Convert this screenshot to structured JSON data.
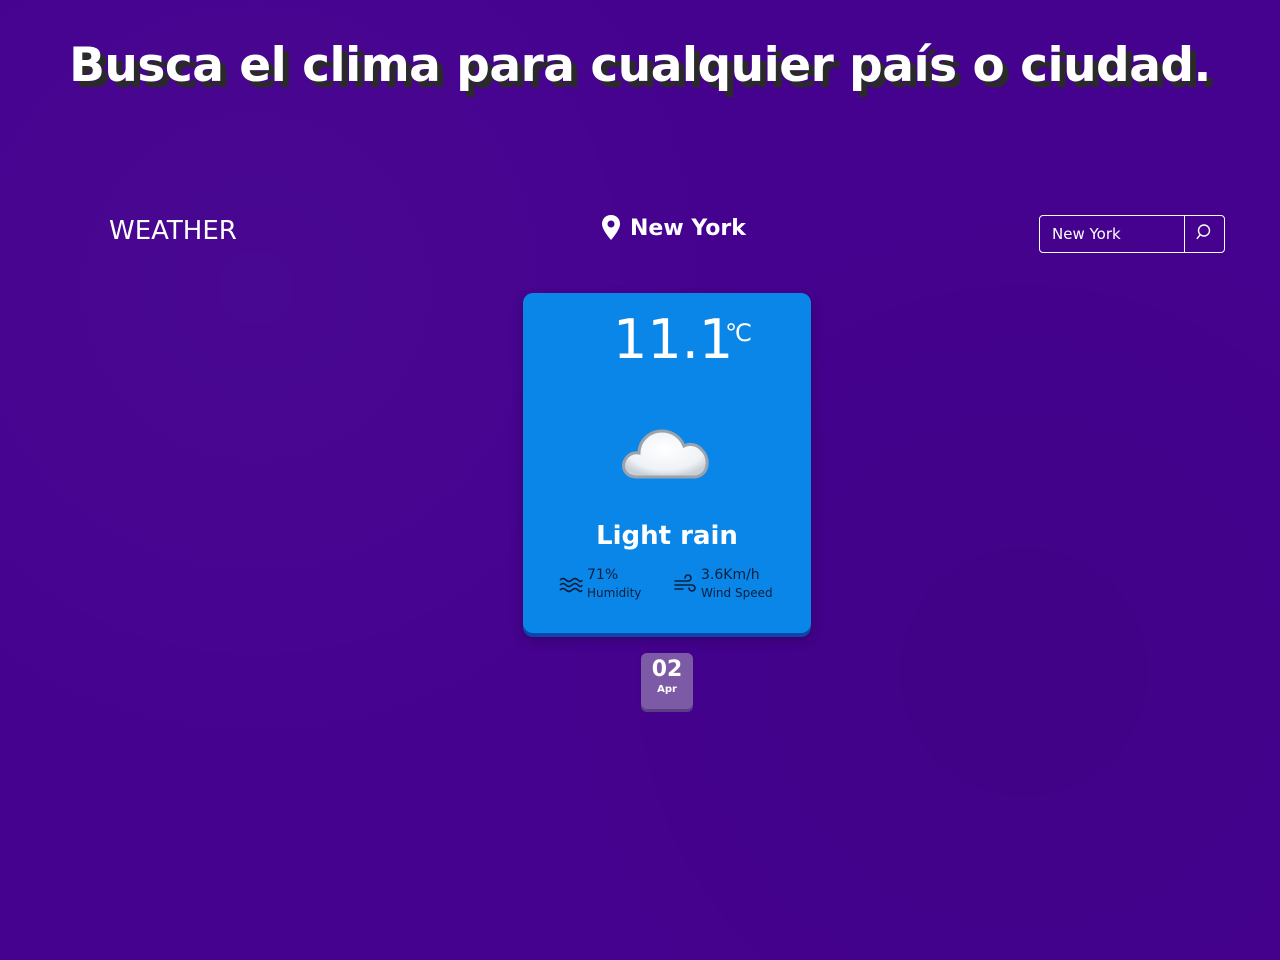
{
  "headline": "Busca el clima para cualquier país o ciudad.",
  "header": {
    "brand": "WEATHER",
    "location_city": "New York",
    "location_icon": "map-pin-icon"
  },
  "search": {
    "value": "New York",
    "placeholder": "",
    "button_icon": "search-icon"
  },
  "weather_card": {
    "temperature": "11.1",
    "unit": "℃",
    "condition_icon": "cloud-icon",
    "condition": "Light rain",
    "humidity": {
      "value": "71%",
      "label": "Humidity",
      "icon": "humidity-waves-icon"
    },
    "wind": {
      "value": "3.6Km/h",
      "label": "Wind Speed",
      "icon": "wind-icon"
    }
  },
  "date": {
    "day": "02",
    "month": "Apr"
  },
  "colors": {
    "background": "#45028f",
    "card": "#0a86e8",
    "date_badge": "#7c5aa6"
  }
}
